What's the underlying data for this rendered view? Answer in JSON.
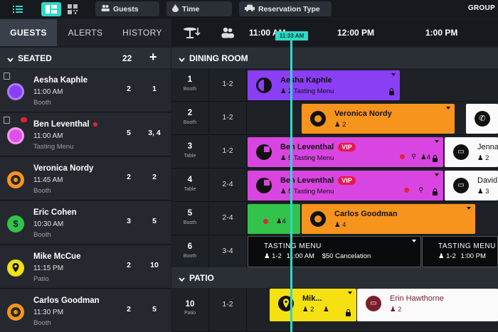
{
  "toolbar": {
    "filters": [
      {
        "label": "Guests",
        "icon": "people-icon"
      },
      {
        "label": "Time",
        "icon": "drop-icon"
      },
      {
        "label": "Reservation Type",
        "icon": "car-icon"
      }
    ],
    "group_label": "GROUP"
  },
  "left": {
    "tabs": [
      "GUESTS",
      "ALERTS",
      "HISTORY"
    ],
    "active_tab": "GUESTS",
    "seated": {
      "label": "SEATED",
      "count": "22",
      "add": "+"
    },
    "guests": [
      {
        "name": "Aesha Kaphle",
        "time": "11:00 AM",
        "sub": "Booth",
        "covers": "2",
        "table": "1",
        "avatar_color": "#8a3ff5"
      },
      {
        "name": "Ben Leventhal",
        "time": "11:00 AM",
        "sub": "Tasting Menu",
        "covers": "5",
        "table": "3, 4",
        "avatar_color": "#e050e8"
      },
      {
        "name": "Veronica Nordy",
        "time": "11:45 AM",
        "sub": "Booth",
        "covers": "2",
        "table": "2",
        "avatar_color": "#f7941d"
      },
      {
        "name": "Eric Cohen",
        "time": "10:30 AM",
        "sub": "Booth",
        "covers": "3",
        "table": "5",
        "avatar_color": "#33c24a"
      },
      {
        "name": "Mike McCue",
        "time": "11:15 PM",
        "sub": "Patio",
        "covers": "2",
        "table": "10",
        "avatar_color": "#f5e012"
      },
      {
        "name": "Carlos Goodman",
        "time": "11:30 PM",
        "sub": "Booth",
        "covers": "2",
        "table": "5",
        "avatar_color": "#f7941d"
      }
    ]
  },
  "timeline": {
    "times": [
      "11:00 AM",
      "12:00 PM",
      "1:00 PM"
    ],
    "now": "11:33 AM",
    "sections": [
      "DINING ROOM",
      "PATIO"
    ],
    "rows": [
      {
        "num": "1",
        "type": "Booth",
        "cap": "1-2"
      },
      {
        "num": "2",
        "type": "Booth",
        "cap": "1-2"
      },
      {
        "num": "3",
        "type": "Table",
        "cap": "1-2"
      },
      {
        "num": "4",
        "type": "Table",
        "cap": "2-4"
      },
      {
        "num": "5",
        "type": "Booth",
        "cap": "2-4"
      },
      {
        "num": "6",
        "type": "Booth",
        "cap": "3-4"
      },
      {
        "num": "10",
        "type": "Patio",
        "cap": "1-2"
      }
    ],
    "reservations": {
      "r1": {
        "name": "Aesha Kaphle",
        "covers": "2",
        "note": "Tasting Menu"
      },
      "r2": {
        "name": "Veronica Nordy",
        "covers": "2"
      },
      "r3": {
        "name": "Ben Leventhal",
        "vip": "VIP",
        "covers": "5",
        "note": "Tasting Menu",
        "right": "4"
      },
      "r3b": {
        "name": "Jenna",
        "covers": "2"
      },
      "r4": {
        "name": "Ben Leventhal",
        "vip": "VIP",
        "covers": "5",
        "note": "Tasting Menu"
      },
      "r4b": {
        "name": "David",
        "covers": "3"
      },
      "r5a": {
        "covers": "4"
      },
      "r5": {
        "name": "Carlos Goodman",
        "covers": "4"
      },
      "r6": {
        "title": "TASTING MENU",
        "covers": "1-2",
        "time": "11:00 AM",
        "price": "$50 Cancelation"
      },
      "r6b": {
        "title": "TASTING MENU",
        "covers": "1-2",
        "time": "1:00 PM"
      },
      "r10": {
        "name": "Mik...",
        "covers": "2"
      },
      "r10b": {
        "name": "Erin Hawthorne",
        "covers": "2"
      }
    }
  },
  "colors": {
    "purple": "#8a3ff5",
    "magenta": "#d845e0",
    "orange": "#f7941d",
    "green": "#33c24a",
    "yellow": "#f5e012",
    "teal_now": "#2fd9c8"
  }
}
